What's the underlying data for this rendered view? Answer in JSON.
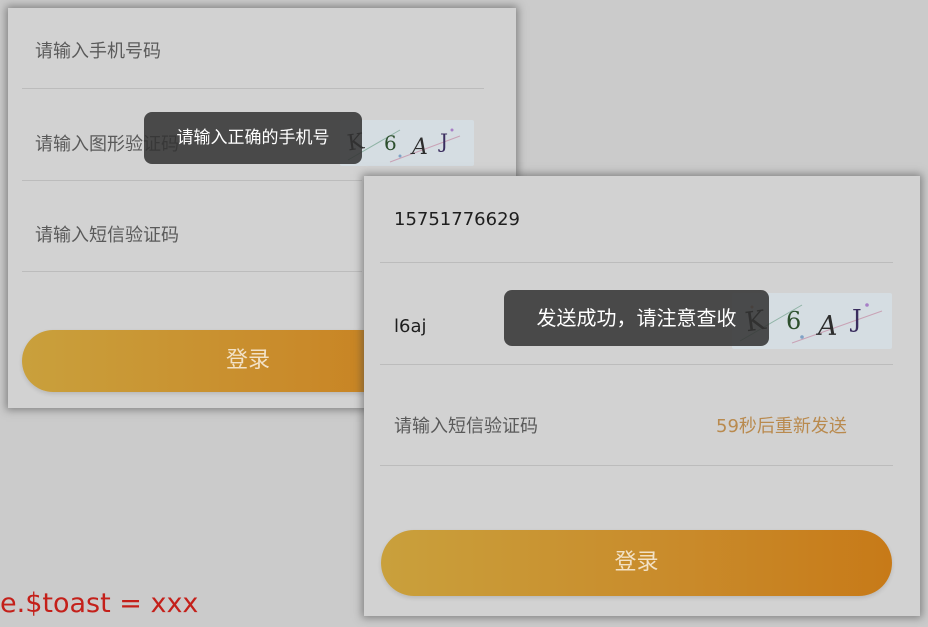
{
  "left_panel": {
    "phone_placeholder": "请输入手机号码",
    "captcha_placeholder": "请输入图形验证码",
    "sms_placeholder": "请输入短信验证码",
    "login_label": "登录",
    "toast_message": "请输入正确的手机号"
  },
  "right_panel": {
    "phone_value": "15751776629",
    "captcha_value": "l6aj",
    "sms_placeholder": "请输入短信验证码",
    "resend_text": "59秒后重新发送",
    "login_label": "登录",
    "toast_message": "发送成功，请注意查收"
  },
  "captcha_image": {
    "text": "K 6 A J"
  },
  "code_label": "e.$toast = xxx",
  "colors": {
    "background": "#cbcbcb",
    "panel": "#d2d2d2",
    "button_start": "#c9a03c",
    "button_end": "#c77a18",
    "resend": "#b98a4e",
    "toast": "#323232",
    "code": "#c4201a"
  }
}
